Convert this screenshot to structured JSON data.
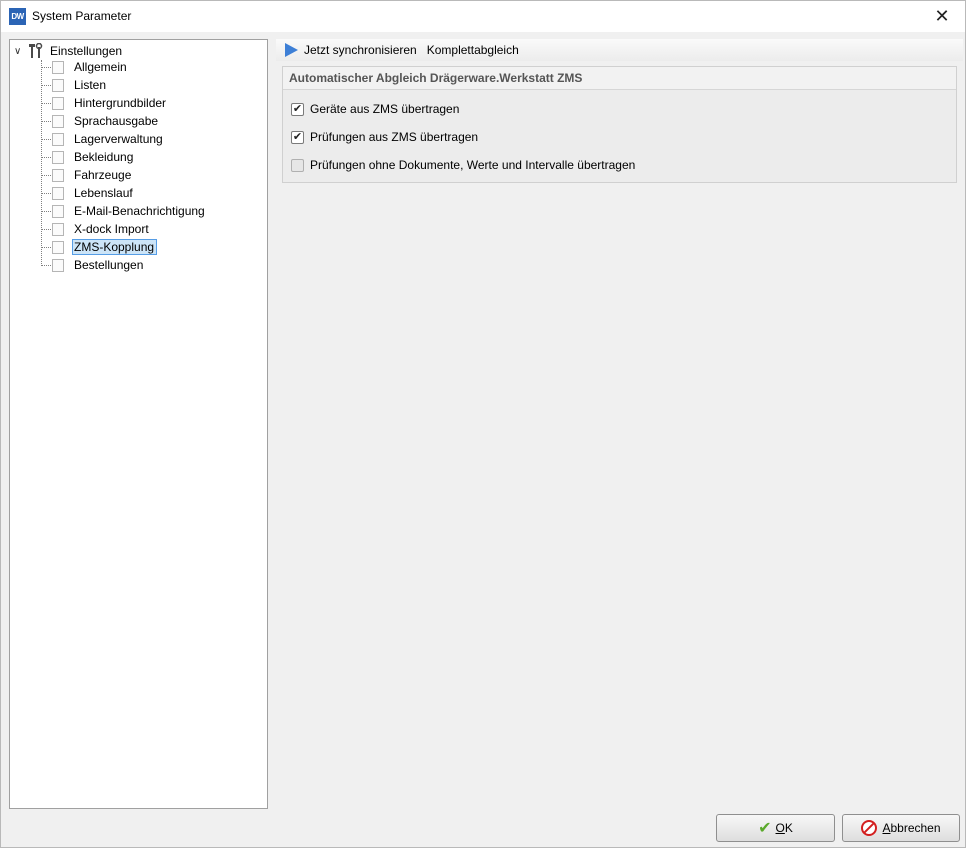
{
  "window": {
    "title": "System Parameter",
    "app_icon_text": "DW"
  },
  "tree": {
    "root_label": "Einstellungen",
    "items": [
      {
        "label": "Allgemein"
      },
      {
        "label": "Listen"
      },
      {
        "label": "Hintergrundbilder"
      },
      {
        "label": "Sprachausgabe"
      },
      {
        "label": "Lagerverwaltung"
      },
      {
        "label": "Bekleidung"
      },
      {
        "label": "Fahrzeuge"
      },
      {
        "label": "Lebenslauf"
      },
      {
        "label": "E-Mail-Benachrichtigung"
      },
      {
        "label": "X-dock Import"
      },
      {
        "label": "ZMS-Kopplung"
      },
      {
        "label": "Bestellungen"
      }
    ],
    "selected": "ZMS-Kopplung"
  },
  "toolbar": {
    "sync_now": "Jetzt synchronisieren",
    "full_sync": "Komplettabgleich"
  },
  "group": {
    "title": "Automatischer Abgleich Drägerware.Werkstatt ZMS",
    "options": [
      {
        "label": "Geräte aus ZMS übertragen",
        "checked": true
      },
      {
        "label": "Prüfungen aus ZMS übertragen",
        "checked": true
      },
      {
        "label": "Prüfungen ohne Dokumente, Werte und Intervalle übertragen",
        "checked": false
      }
    ]
  },
  "buttons": {
    "ok_first": "O",
    "ok_rest": "K",
    "cancel_first": "A",
    "cancel_rest": "bbrechen"
  },
  "colors": {
    "accent": "#3d7fd6",
    "selection": "#cce4f7",
    "ok_icon": "#5aa92b",
    "cancel_icon": "#d31f1f"
  }
}
